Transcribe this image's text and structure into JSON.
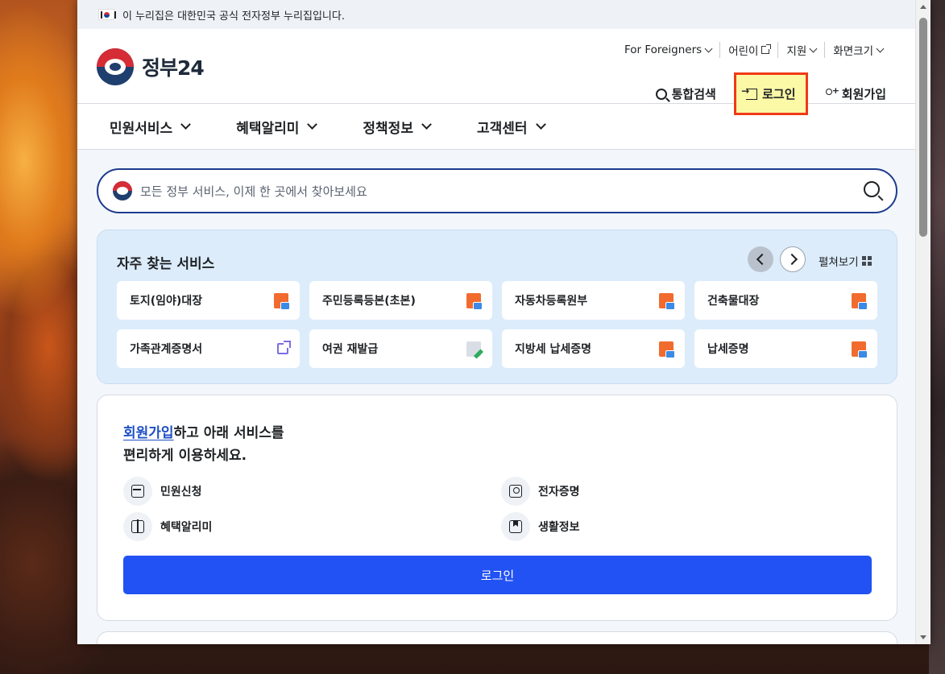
{
  "banner": {
    "text": "이 누리집은 대한민국 공식 전자정부 누리집입니다."
  },
  "logo": {
    "text": "정부24",
    "icon": "taegeuk-logo"
  },
  "top_links": [
    {
      "label": "For Foreigners",
      "icon": "chevron-down-icon"
    },
    {
      "label": "어린이",
      "icon": "external-link-icon"
    },
    {
      "label": "지원",
      "icon": "chevron-down-icon"
    },
    {
      "label": "화면크기",
      "icon": "chevron-down-icon"
    }
  ],
  "actions": {
    "search_label": "통합검색",
    "login_label": "로그인",
    "signup_label": "회원가입"
  },
  "nav": [
    {
      "label": "민원서비스"
    },
    {
      "label": "혜택알리미"
    },
    {
      "label": "정책정보"
    },
    {
      "label": "고객센터"
    }
  ],
  "search": {
    "placeholder": "모든 정부 서비스, 이제 한 곳에서 찾아보세요"
  },
  "frequent": {
    "title": "자주 찾는 서비스",
    "expand_label": "펼쳐보기",
    "items": [
      {
        "label": "토지(임야)대장",
        "icon": "pdf-icon"
      },
      {
        "label": "주민등록등본(초본)",
        "icon": "pdf-icon"
      },
      {
        "label": "자동차등록원부",
        "icon": "pdf-icon"
      },
      {
        "label": "건축물대장",
        "icon": "pdf-icon"
      },
      {
        "label": "가족관계증명서",
        "icon": "external-link-icon"
      },
      {
        "label": "여권 재발급",
        "icon": "edit-icon"
      },
      {
        "label": "지방세 납세증명",
        "icon": "pdf-icon"
      },
      {
        "label": "납세증명",
        "icon": "pdf-icon"
      }
    ]
  },
  "signup_card": {
    "link_text": "회원가입",
    "line1_rest": "하고 아래 서비스를",
    "line2": "편리하게 이용하세요.",
    "features": [
      {
        "label": "민원신청",
        "icon": "inbox-icon"
      },
      {
        "label": "전자증명",
        "icon": "certificate-icon"
      },
      {
        "label": "혜택알리미",
        "icon": "gift-icon"
      },
      {
        "label": "생활정보",
        "icon": "bookmark-icon"
      }
    ],
    "login_button": "로그인"
  },
  "colors": {
    "primary_button": "#2252f3",
    "highlight_fill": "#fbf8a6",
    "highlight_border": "#f03a17",
    "search_border": "#1d3c8f"
  }
}
